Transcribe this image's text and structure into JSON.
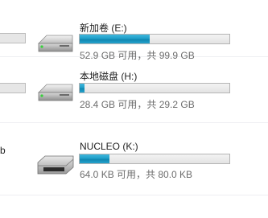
{
  "left_partial": {
    "label_b": "b"
  },
  "drives": [
    {
      "name": "新加卷 (E:)",
      "info": "52.9 GB 可用，共 99.9 GB",
      "used_fraction": 0.47,
      "icon": "hard-drive-icon"
    },
    {
      "name": "本地磁盘 (H:)",
      "info": "28.4 GB 可用，共 29.2 GB",
      "used_fraction": 0.03,
      "icon": "hard-drive-icon"
    },
    {
      "name": "NUCLEO (K:)",
      "info": "64.0 KB 可用，共 80.0 KB",
      "used_fraction": 0.2,
      "icon": "removable-drive-icon"
    }
  ]
}
